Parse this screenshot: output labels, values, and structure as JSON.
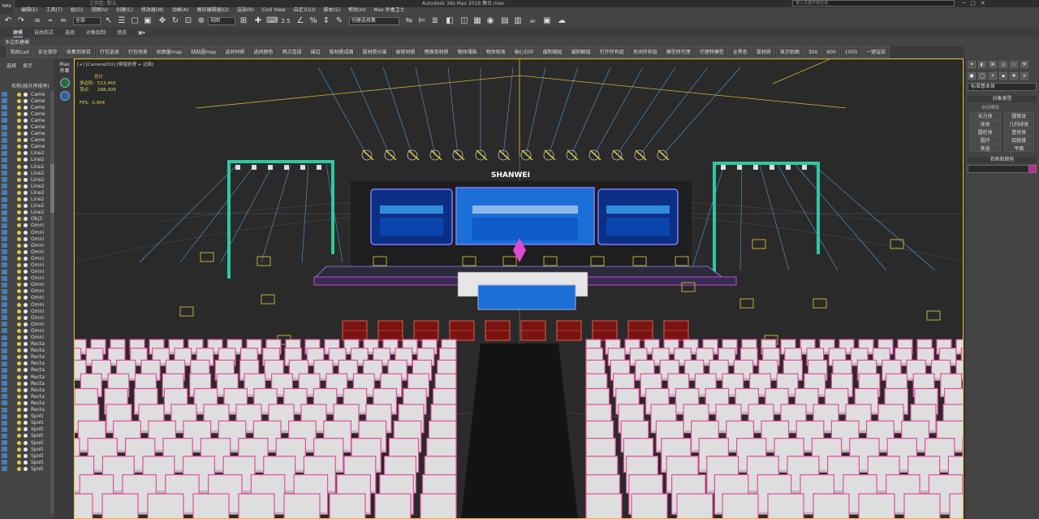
{
  "window": {
    "title": "Autodesk 3ds Max 2016    舞台.max",
    "file": "工作区: 默认",
    "search_placeholder": "键入关键字或短语",
    "logo": "MAX"
  },
  "menu": [
    "编辑(E)",
    "工具(T)",
    "组(G)",
    "视图(V)",
    "创建(C)",
    "修改器(M)",
    "动画(A)",
    "图形编辑器(D)",
    "渲染(R)",
    "Civil View",
    "自定义(U)",
    "脚本(S)",
    "帮助(H)",
    "Max 杀毒卫士"
  ],
  "toolbar": {
    "filter": "全部",
    "view": "视图",
    "selection_set": "创建选择集",
    "snap_value": "2.5"
  },
  "ribbon": {
    "tabs": [
      "建模",
      "自由形式",
      "选择",
      "对象绘制",
      "填充"
    ],
    "active": "建模",
    "subtitle": "多边形建模"
  },
  "tools": [
    "粘贴cad",
    "安全保存",
    "收集到项目",
    "打包选择",
    "打包场景",
    "贴图量map",
    "粘贴圈map",
    "选同材质",
    "选同颜色",
    "两点连接",
    "描边",
    "拔材质成面",
    "拔材质分离",
    "偷取材质",
    "替换到材质",
    "物体塌陷",
    "物体吸地",
    "轴心归中",
    "缓制辅组",
    "缓制解组",
    "打开所有组",
    "关闭所有组",
    "模型转代理",
    "代理转模型",
    "全黑色",
    "拔材质",
    "显示贴图",
    "300",
    "600",
    "1000",
    "一键渲染"
  ],
  "scene": {
    "tabs": [
      "选择",
      "显示"
    ],
    "header": "名称(按升序排序)",
    "items": [
      "Came",
      "Came",
      "Came",
      "Came",
      "Came",
      "Came",
      "Came",
      "Came",
      "Came",
      "Line2",
      "Line2",
      "Line2",
      "Line2",
      "Line2",
      "Line2",
      "Line2",
      "Line2",
      "Line2",
      "Line2",
      "Obj3",
      "Omni",
      "Omni",
      "Omni",
      "Omni",
      "Omni",
      "Omni",
      "Omni",
      "Omni",
      "Omni",
      "Omni",
      "Omni",
      "Omni",
      "Omni",
      "Omni",
      "Omni",
      "Omni",
      "Omni",
      "Omni",
      "Recta",
      "Recta",
      "Recta",
      "Recta",
      "Recta",
      "Recta",
      "Recta",
      "Recta",
      "Recta",
      "Recta",
      "Recta",
      "Spoti",
      "Spoti",
      "Spoti",
      "Spoti",
      "Spoti",
      "Spoti",
      "Spoti",
      "Spoti",
      "Spoti"
    ]
  },
  "side_strip": {
    "label_top": "Max",
    "label_bottom": "杀毒"
  },
  "viewport": {
    "label": "[+] [Camera010] [明暗处理 + 边面]",
    "stats_title": "总计",
    "polys_label": "多边形:",
    "polys": "513,465",
    "verts_label": "顶点:",
    "verts": "298,309",
    "fps_label": "FPS:",
    "fps": "0.904",
    "brand": "SHANWEI"
  },
  "command_panel": {
    "dropdown": "标准基本体",
    "object_type": "对象类型",
    "autogrid": "自动栅格",
    "objects": [
      "长方体",
      "圆锥体",
      "球体",
      "几何球体",
      "圆柱体",
      "管状体",
      "圆环",
      "四棱锥",
      "茶壶",
      "平面"
    ],
    "name_color": "名称和颜色"
  },
  "colors": {
    "truss": "#2fc7a2",
    "screen": "#1b6fd6",
    "chair_outline": "#e14fa0",
    "chair_fill": "#dedede",
    "light_rays": "#5fb8ff",
    "viewport_border": "#e0c030"
  }
}
